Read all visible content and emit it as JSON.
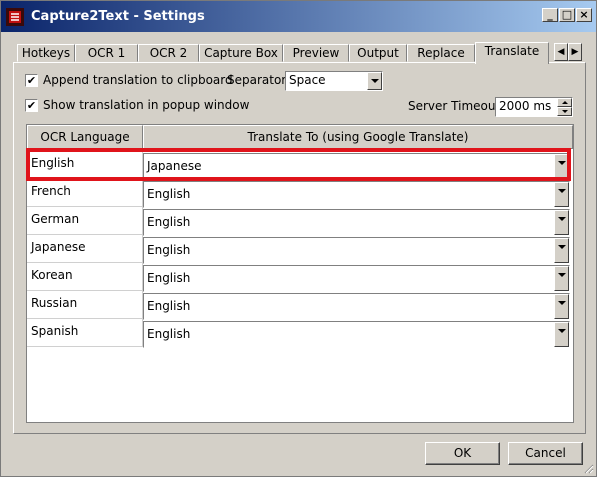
{
  "window": {
    "title": "Capture2Text - Settings",
    "buttons": {
      "minimize": "_",
      "maximize": "□",
      "close": "×"
    }
  },
  "tabs": [
    "Hotkeys",
    "OCR 1",
    "OCR 2",
    "Capture Box",
    "Preview",
    "Output",
    "Replace",
    "Translate"
  ],
  "active_tab": "Translate",
  "translate": {
    "append_label": "Append translation to clipboard",
    "append_checked": true,
    "popup_label": "Show translation in popup window",
    "popup_checked": true,
    "separator_label": "Separator:",
    "separator_value": "Space",
    "timeout_label": "Server Timeout:",
    "timeout_value": "2000 ms"
  },
  "table": {
    "headers": [
      "OCR Language",
      "Translate To (using Google Translate)"
    ],
    "rows": [
      {
        "lang": "English",
        "target": "Japanese"
      },
      {
        "lang": "French",
        "target": "English"
      },
      {
        "lang": "German",
        "target": "English"
      },
      {
        "lang": "Japanese",
        "target": "English"
      },
      {
        "lang": "Korean",
        "target": "English"
      },
      {
        "lang": "Russian",
        "target": "English"
      },
      {
        "lang": "Spanish",
        "target": "English"
      }
    ]
  },
  "footer": {
    "ok": "OK",
    "cancel": "Cancel"
  },
  "colors": {
    "titlebar_start": "#0a246a",
    "titlebar_end": "#a6caf0",
    "highlight": "#e0141b"
  }
}
